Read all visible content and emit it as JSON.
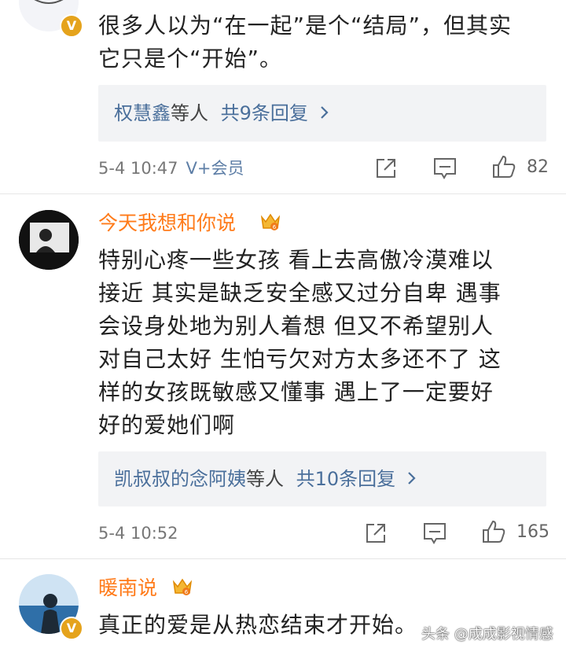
{
  "comments": [
    {
      "text_lines": [
        "很多人以为“在一起”是个“结局”，但其实",
        "它只是个“开始”。"
      ],
      "reply": {
        "names": "权慧鑫",
        "suffix": "等人",
        "count": "共9条回复"
      },
      "time": "5-4 10:47",
      "vip": "V+会员",
      "likes": "82"
    },
    {
      "username": "今天我想和你说",
      "text_lines": [
        "特别心疼一些女孩 看上去高傲冷漠难以",
        "接近 其实是缺乏安全感又过分自卑 遇事",
        "会设身处地为别人着想 但又不希望别人",
        "对自己太好 生怕亏欠对方太多还不了 这",
        "样的女孩既敏感又懂事 遇上了一定要好",
        "好的爱她们啊"
      ],
      "reply": {
        "names": "凯叔叔的念阿姨",
        "suffix": "等人",
        "count": "共10条回复"
      },
      "time": "5-4 10:52",
      "likes": "165"
    },
    {
      "username": "暖南说",
      "text_lines": [
        "真正的爱是从热恋结束才开始。"
      ]
    }
  ],
  "badge_v": "V",
  "watermark": "头条 @成成影视情感",
  "icons": [
    "share-icon",
    "comment-icon",
    "like-icon",
    "crown-icon",
    "chevron-right-icon"
  ],
  "colors": {
    "username": "#ff7b1a",
    "link": "#4a6f9b",
    "reply_bg": "#f2f3f5",
    "badge": "#e5a31c"
  }
}
